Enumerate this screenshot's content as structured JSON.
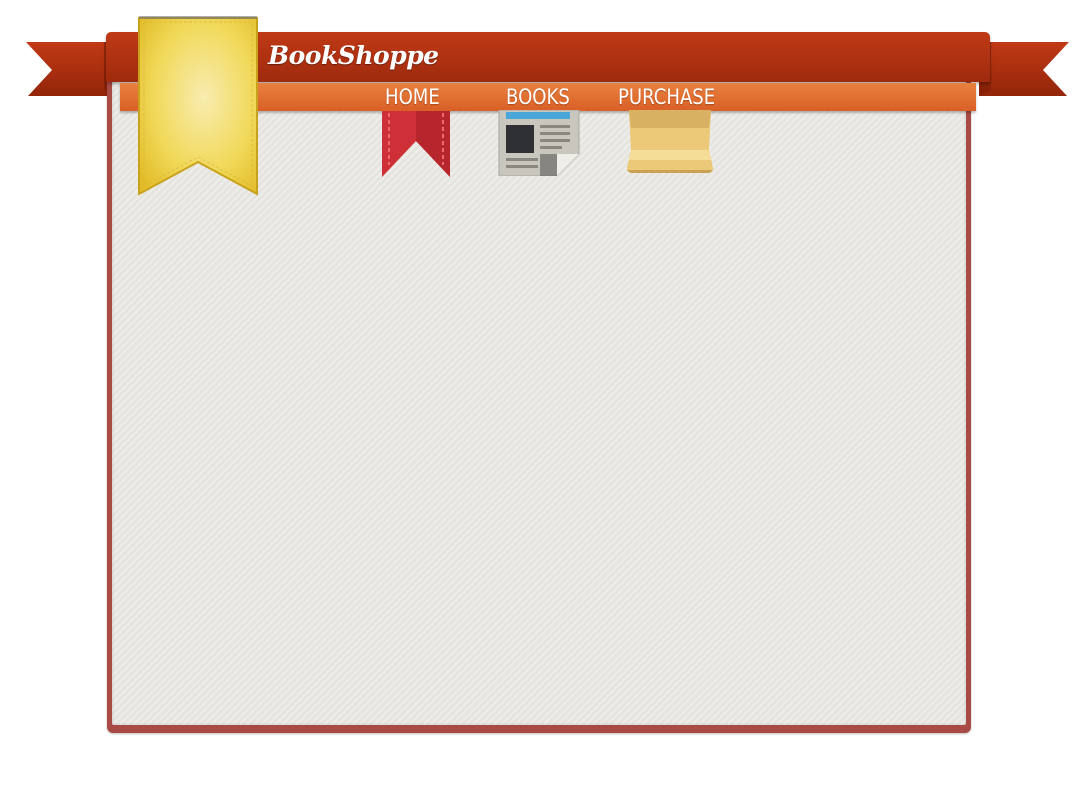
{
  "brand": {
    "name": "BookShoppe"
  },
  "nav": {
    "items": [
      {
        "label": "HOME",
        "icon": "bookmark-icon"
      },
      {
        "label": "BOOKS",
        "icon": "newspaper-icon"
      },
      {
        "label": "PURCHASE",
        "icon": "box-icon"
      }
    ]
  },
  "colors": {
    "ribbon_red": "#b2330f",
    "nav_orange": "#e27233",
    "bookmark_yellow": "#f3d64b",
    "panel_border": "#a84b45",
    "panel_bg": "#e6e4df",
    "home_icon_red": "#cf2f36",
    "books_icon_blue": "#4aa6d8",
    "purchase_icon_tan": "#e9c877"
  }
}
